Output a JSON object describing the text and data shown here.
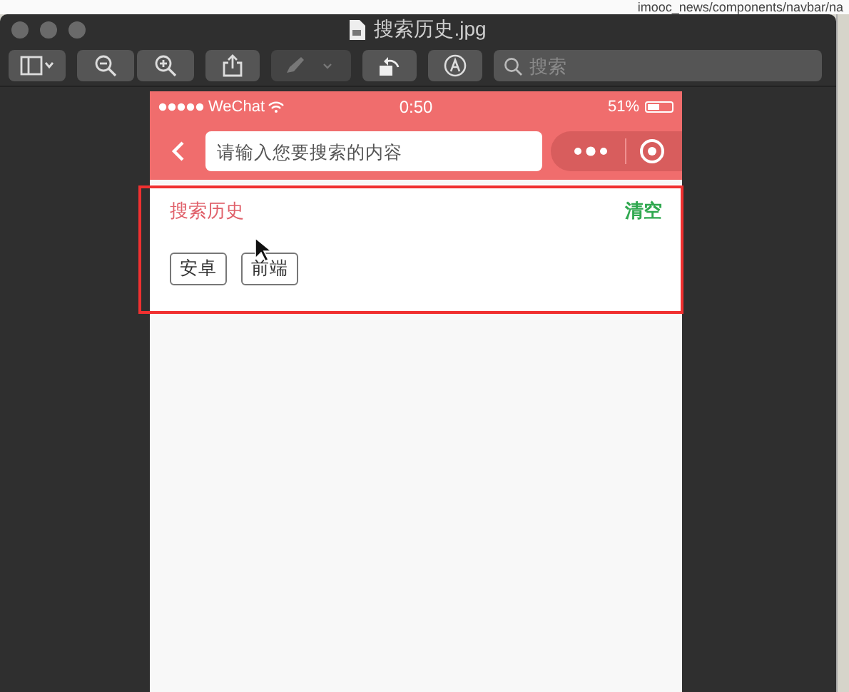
{
  "background_editor": {
    "path": "imooc_news/components/navbar/na"
  },
  "window": {
    "title": "搜索历史.jpg",
    "search": {
      "placeholder": "搜索"
    }
  },
  "phone": {
    "status_bar": {
      "carrier": "WeChat",
      "time": "0:50",
      "battery": "51%"
    },
    "nav": {
      "search": {
        "placeholder": "请输入您要搜索的内容"
      }
    },
    "history": {
      "title": "搜索历史",
      "clear": "清空",
      "tags": [
        "安卓",
        "前端"
      ]
    }
  }
}
